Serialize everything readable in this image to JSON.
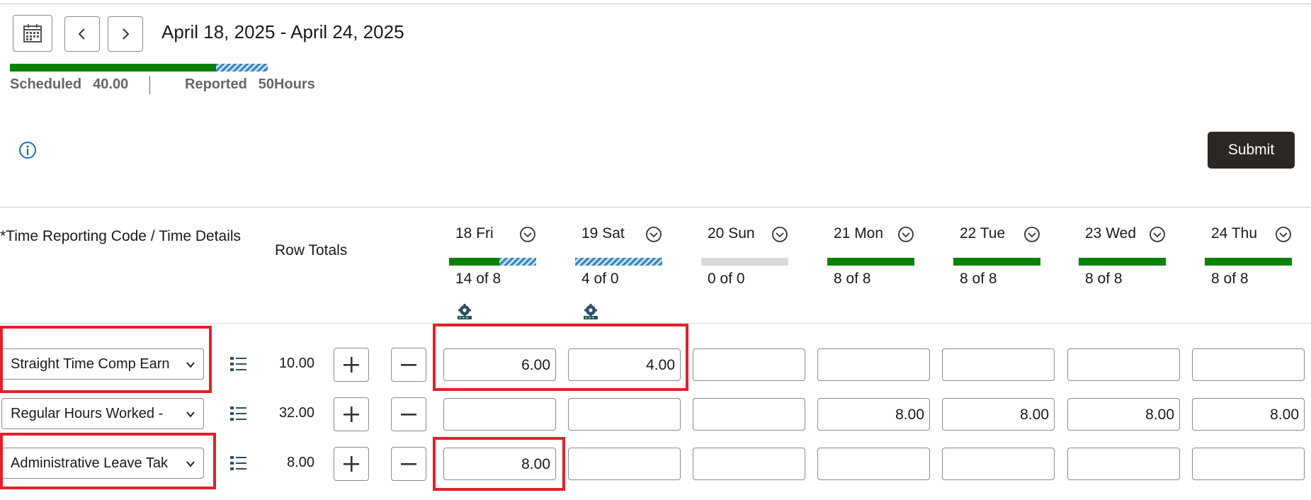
{
  "header": {
    "calendar_icon": "calendar-icon",
    "prev_icon": "chevron-left-icon",
    "next_icon": "chevron-right-icon",
    "date_range": "April 18, 2025 - April 24, 2025"
  },
  "summary": {
    "scheduled_label": "Scheduled",
    "scheduled_value": "40.00",
    "reported_label": "Reported",
    "reported_value": "50Hours",
    "progress_scheduled_fraction": 0.8,
    "progress_over_fraction": 0.2
  },
  "actions": {
    "info_icon": "info-icon",
    "submit_label": "Submit"
  },
  "grid": {
    "col_trc": "*Time Reporting Code / Time Details",
    "col_totals": "Row Totals",
    "days": [
      {
        "label": "18 Fri",
        "count": "14 of 8",
        "bar": "over",
        "has_gear": true
      },
      {
        "label": "19 Sat",
        "count": "4 of 0",
        "bar": "hatch",
        "has_gear": true
      },
      {
        "label": "20 Sun",
        "count": "0 of 0",
        "bar": "grey",
        "has_gear": false
      },
      {
        "label": "21 Mon",
        "count": "8 of 8",
        "bar": "green",
        "has_gear": false
      },
      {
        "label": "22 Tue",
        "count": "8 of 8",
        "bar": "green",
        "has_gear": false
      },
      {
        "label": "23 Wed",
        "count": "8 of 8",
        "bar": "green",
        "has_gear": false
      },
      {
        "label": "24 Thu",
        "count": "8 of 8",
        "bar": "green",
        "has_gear": false
      }
    ],
    "rows": [
      {
        "code": "Straight Time Comp Earn",
        "total": "10.00",
        "cells": [
          "6.00",
          "4.00",
          "",
          "",
          "",
          "",
          ""
        ]
      },
      {
        "code": "Regular Hours Worked -",
        "total": "32.00",
        "cells": [
          "",
          "",
          "",
          "8.00",
          "8.00",
          "8.00",
          "8.00"
        ]
      },
      {
        "code": "Administrative Leave Tak",
        "total": "8.00",
        "cells": [
          "8.00",
          "",
          "",
          "",
          "",
          "",
          ""
        ]
      }
    ]
  },
  "colors": {
    "accent_green": "#0a820a",
    "highlight_red": "#e3202a",
    "submit_bg": "#2b2725",
    "info_blue": "#1f6fa8"
  }
}
